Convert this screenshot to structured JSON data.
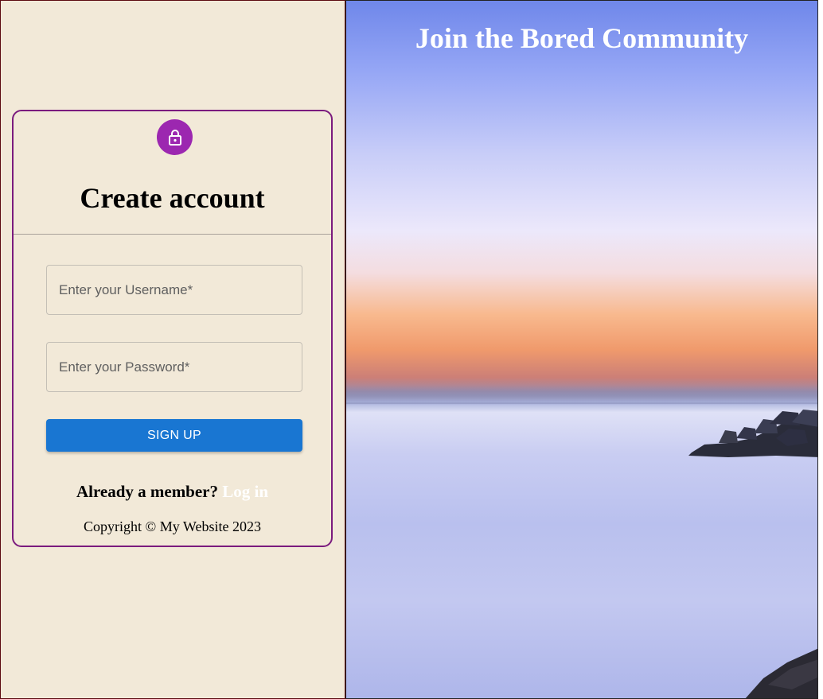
{
  "colors": {
    "panel_background": "#f2e9d8",
    "card_border": "#7b1b7e",
    "avatar": "#9c27b0",
    "primary_button": "#1976d2",
    "link": "#ffffff",
    "hero_text": "#ffffff"
  },
  "signup_form": {
    "icon": "lock-icon",
    "title": "Create account",
    "username_placeholder": "Enter your Username*",
    "username_value": "",
    "password_placeholder": "Enter your Password*",
    "password_value": "",
    "submit_label": "SIGN UP",
    "member_prompt": "Already a member?",
    "login_link": "Log in",
    "copyright": "Copyright © My Website 2023"
  },
  "hero": {
    "heading": "Join the Bored Community"
  }
}
